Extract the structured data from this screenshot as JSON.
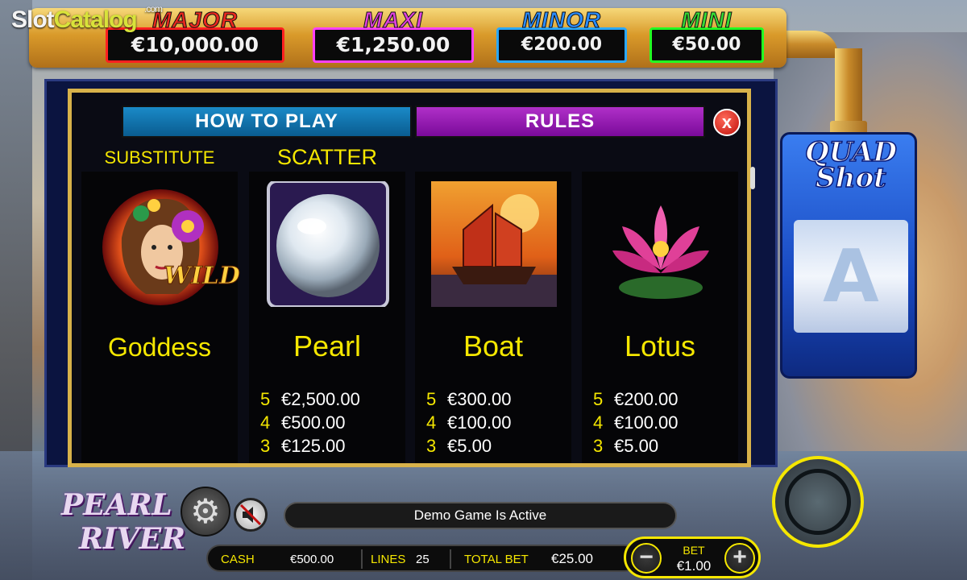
{
  "watermark": {
    "prefix": "Slot",
    "accent": "Catalog",
    "suffix": ".com"
  },
  "jackpots": [
    {
      "name": "MAJOR",
      "value": "€10,000.00"
    },
    {
      "name": "MAXI",
      "value": "€1,250.00"
    },
    {
      "name": "MINOR",
      "value": "€200.00"
    },
    {
      "name": "MINI",
      "value": "€50.00"
    }
  ],
  "quad_shot": {
    "line1": "QUAD",
    "line2": "Shot",
    "reel_symbol": "A"
  },
  "tabs": {
    "how_to_play": "HOW TO PLAY",
    "rules": "RULES"
  },
  "close_label": "x",
  "symbols": [
    {
      "label": "SUBSTITUTE",
      "name": "Goddess",
      "badge": "WILD",
      "icon": "goddess-wild-icon",
      "pays": []
    },
    {
      "label": "SCATTER",
      "name": "Pearl",
      "icon": "pearl-icon",
      "pays": [
        {
          "count": "5",
          "amount": "€2,500.00"
        },
        {
          "count": "4",
          "amount": "€500.00"
        },
        {
          "count": "3",
          "amount": "€125.00"
        }
      ]
    },
    {
      "label": "",
      "name": "Boat",
      "icon": "boat-icon",
      "pays": [
        {
          "count": "5",
          "amount": "€300.00"
        },
        {
          "count": "4",
          "amount": "€100.00"
        },
        {
          "count": "3",
          "amount": "€5.00"
        }
      ]
    },
    {
      "label": "",
      "name": "Lotus",
      "icon": "lotus-icon",
      "pays": [
        {
          "count": "5",
          "amount": "€200.00"
        },
        {
          "count": "4",
          "amount": "€100.00"
        },
        {
          "count": "3",
          "amount": "€5.00"
        }
      ]
    }
  ],
  "game_logo": {
    "line1": "PEARL",
    "line2": "RIVER"
  },
  "status_message": "Demo Game Is Active",
  "info_bar": {
    "cash_label": "CASH",
    "cash_value": "€500.00",
    "lines_label": "LINES",
    "lines_value": "25",
    "total_bet_label": "TOTAL BET",
    "total_bet_value": "€25.00"
  },
  "bet": {
    "label": "BET",
    "value": "€1.00",
    "minus": "−",
    "plus": "+"
  },
  "colors": {
    "accent_yellow": "#f5e700",
    "panel_border": "#d8b24a",
    "how_to_play_tab": "#1a8ac8",
    "rules_tab": "#b030c8"
  }
}
